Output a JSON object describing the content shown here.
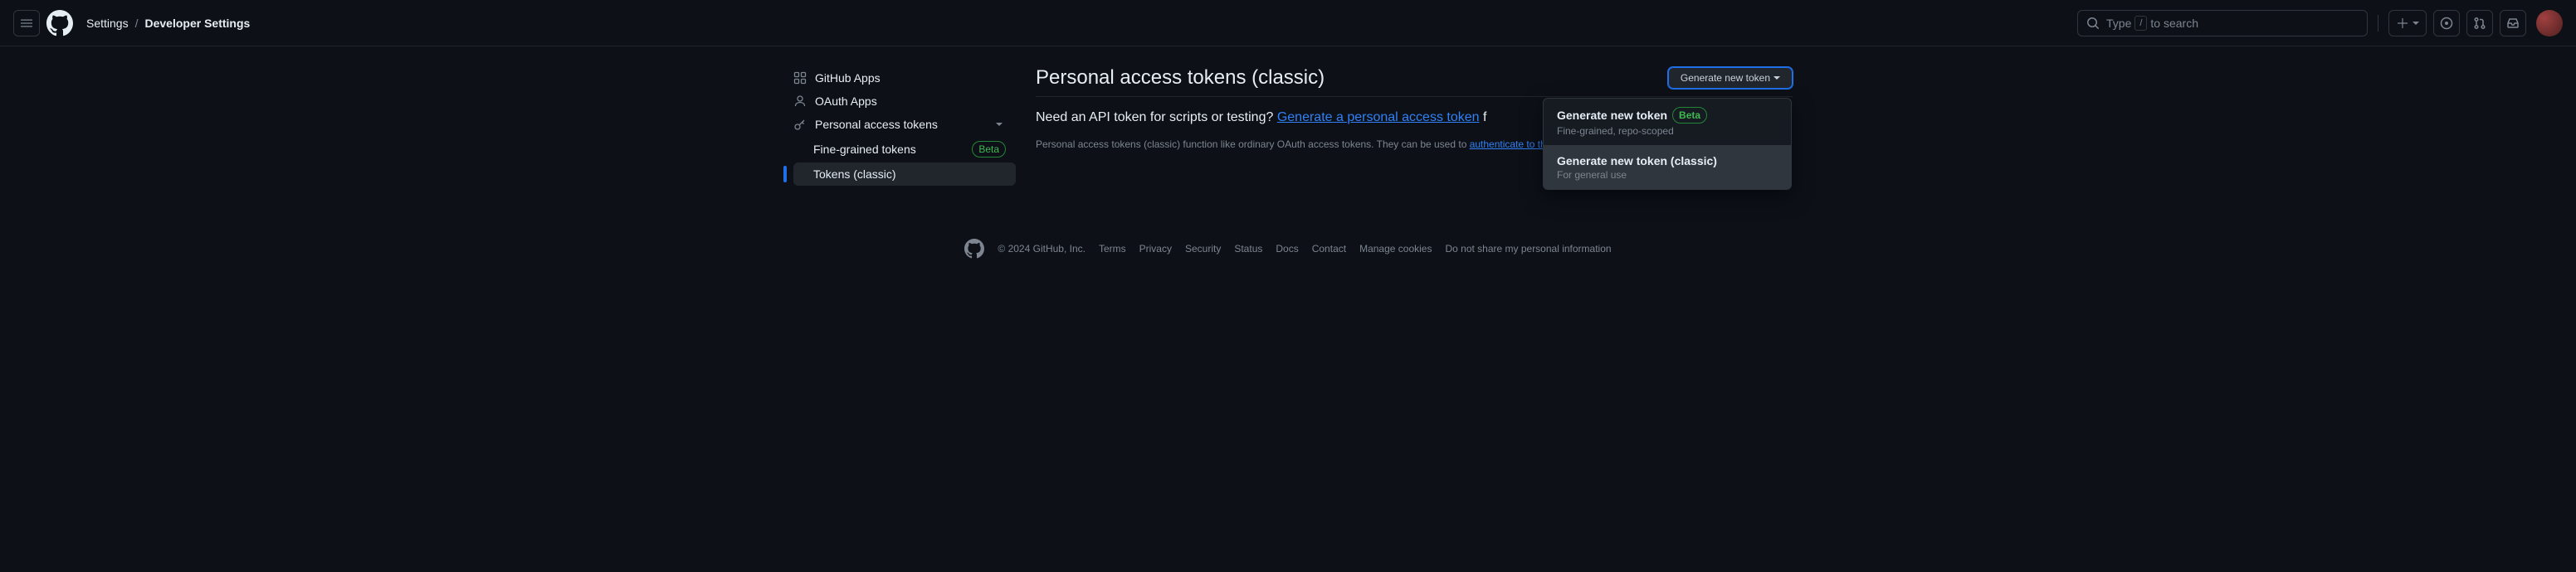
{
  "header": {
    "breadcrumb_settings": "Settings",
    "breadcrumb_sep": "/",
    "breadcrumb_current": "Developer Settings",
    "search_prefix": "Type",
    "search_key": "/",
    "search_suffix": "to search"
  },
  "sidebar": {
    "github_apps": "GitHub Apps",
    "oauth_apps": "OAuth Apps",
    "pat": "Personal access tokens",
    "fine_grained": "Fine-grained tokens",
    "fine_grained_badge": "Beta",
    "tokens_classic": "Tokens (classic)"
  },
  "page": {
    "title": "Personal access tokens (classic)",
    "gen_button": "Generate new token",
    "dropdown": {
      "item1_title": "Generate new token",
      "item1_badge": "Beta",
      "item1_sub": "Fine-grained, repo-scoped",
      "item2_title": "Generate new token (classic)",
      "item2_sub": "For general use"
    },
    "intro_text": "Need an API token for scripts or testing? ",
    "intro_link": "Generate a personal access token",
    "intro_after": " f",
    "desc_before": "Personal access tokens (classic) function like ordinary OAuth access tokens. They can be used to ",
    "desc_link": "authenticate to the API over Basic Authentication",
    "desc_after": "."
  },
  "footer": {
    "copyright": "© 2024 GitHub, Inc.",
    "links": [
      "Terms",
      "Privacy",
      "Security",
      "Status",
      "Docs",
      "Contact",
      "Manage cookies",
      "Do not share my personal information"
    ]
  }
}
